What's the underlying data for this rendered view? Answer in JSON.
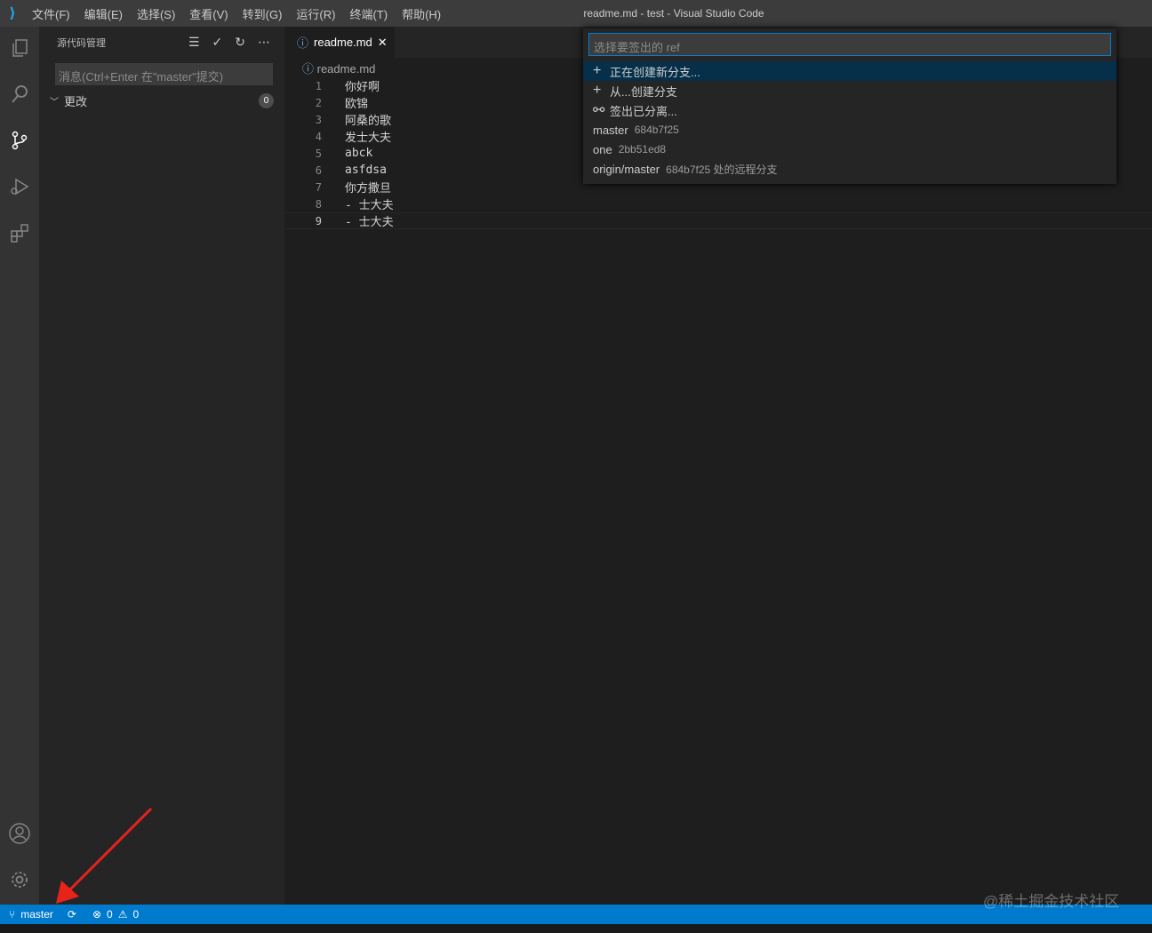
{
  "titlebar": {
    "menus": [
      "文件(F)",
      "编辑(E)",
      "选择(S)",
      "查看(V)",
      "转到(G)",
      "运行(R)",
      "终端(T)",
      "帮助(H)"
    ],
    "title": "readme.md - test - Visual Studio Code"
  },
  "sidebar": {
    "title": "源代码管理",
    "message_placeholder": "消息(Ctrl+Enter 在\"master\"提交)",
    "changes_label": "更改",
    "changes_count": "0"
  },
  "editor": {
    "tab": "readme.md",
    "breadcrumb": "readme.md",
    "lines": [
      {
        "n": "1",
        "t": "你好啊"
      },
      {
        "n": "2",
        "t": "欧锦"
      },
      {
        "n": "3",
        "t": "阿桑的歌"
      },
      {
        "n": "4",
        "t": "发士大夫"
      },
      {
        "n": "5",
        "t": "abck"
      },
      {
        "n": "6",
        "t": "asfdsa"
      },
      {
        "n": "7",
        "t": "你方撒旦"
      },
      {
        "n": "8",
        "t": "- 士大夫"
      },
      {
        "n": "9",
        "t": "- 士大夫"
      }
    ]
  },
  "quickpick": {
    "placeholder": "选择要签出的 ref",
    "items": [
      {
        "icon": "+",
        "label": "正在创建新分支...",
        "desc": ""
      },
      {
        "icon": "+",
        "label": "从...创建分支",
        "desc": ""
      },
      {
        "icon": "⚯",
        "label": "签出已分离...",
        "desc": ""
      },
      {
        "icon": "",
        "label": "master",
        "desc": "684b7f25"
      },
      {
        "icon": "",
        "label": "one",
        "desc": "2bb51ed8"
      },
      {
        "icon": "",
        "label": "origin/master",
        "desc": "684b7f25 处的远程分支"
      }
    ]
  },
  "status": {
    "branch": "master",
    "errors": "0",
    "warnings": "0"
  },
  "watermark": "@稀土掘金技术社区",
  "colors": {
    "accent": "#007acc",
    "selection": "#062f4a",
    "annotation_arrow": "#e8231a"
  }
}
